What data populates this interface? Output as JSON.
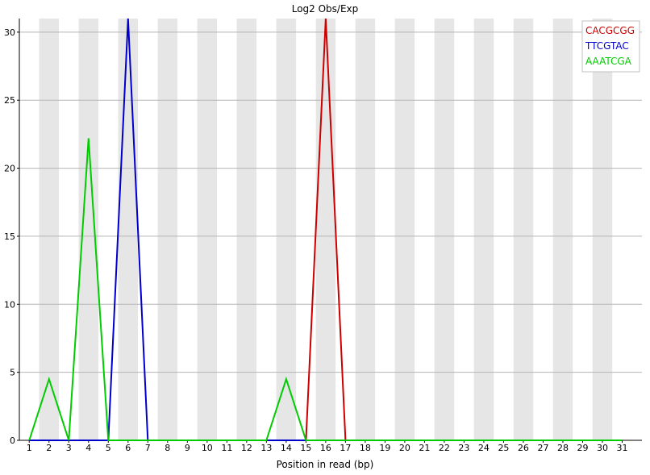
{
  "chart_data": {
    "type": "line",
    "title": "Log2 Obs/Exp",
    "xlabel": "Position in read (bp)",
    "ylabel": "",
    "categories": [
      "1",
      "2",
      "3",
      "4",
      "5",
      "6",
      "7",
      "8",
      "9",
      "10",
      "11",
      "12",
      "13",
      "14",
      "15",
      "16",
      "17",
      "18",
      "19",
      "20",
      "21",
      "22",
      "23",
      "24",
      "25",
      "26",
      "27",
      "28",
      "29",
      "30",
      "31"
    ],
    "ylim": [
      0,
      31
    ],
    "yticks": [
      0,
      5,
      10,
      15,
      20,
      25,
      30
    ],
    "grid": true,
    "legend_position": "top-right",
    "series": [
      {
        "name": "CACGCGG",
        "color": "#cc0000",
        "values": [
          0,
          0,
          0,
          0,
          0,
          0,
          0,
          0,
          0,
          0,
          0,
          0,
          0,
          0,
          0,
          31,
          0,
          0,
          0,
          0,
          0,
          0,
          0,
          0,
          0,
          0,
          0,
          0,
          0,
          0,
          0
        ]
      },
      {
        "name": "TTCGTAC",
        "color": "#0000cc",
        "values": [
          0,
          0,
          0,
          0,
          0,
          31,
          0,
          0,
          0,
          0,
          0,
          0,
          0,
          0,
          0,
          0,
          0,
          0,
          0,
          0,
          0,
          0,
          0,
          0,
          0,
          0,
          0,
          0,
          0,
          0,
          0
        ]
      },
      {
        "name": "AAATCGA",
        "color": "#00cc00",
        "values": [
          0,
          4.5,
          0,
          22.2,
          0,
          0,
          0,
          0,
          0,
          0,
          0,
          0,
          0,
          4.5,
          0,
          0,
          0,
          0,
          0,
          0,
          0,
          0,
          0,
          0,
          0,
          0,
          0,
          0,
          0,
          0,
          0
        ]
      }
    ]
  }
}
